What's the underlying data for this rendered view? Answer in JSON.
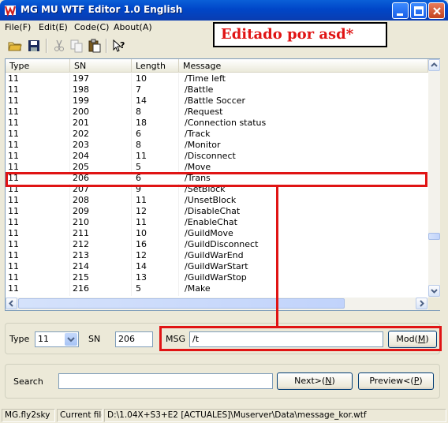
{
  "window": {
    "title": "MG MU WTF Editor 1.0 English"
  },
  "menu": [
    "File(F)",
    "Edit(E)",
    "Code(C)",
    "About(A)"
  ],
  "toolbar": {
    "icons": [
      "open-folder-icon",
      "save-icon",
      "cut-icon",
      "copy-icon",
      "paste-icon",
      "help-icon"
    ]
  },
  "banner": {
    "text": "Editado por asd*"
  },
  "list": {
    "columns": [
      "Type",
      "SN",
      "Length",
      "Message"
    ],
    "rows": [
      {
        "type": "11",
        "sn": "197",
        "length": "10",
        "message": "/Time left"
      },
      {
        "type": "11",
        "sn": "198",
        "length": "7",
        "message": "/Battle"
      },
      {
        "type": "11",
        "sn": "199",
        "length": "14",
        "message": "/Battle Soccer"
      },
      {
        "type": "11",
        "sn": "200",
        "length": "8",
        "message": "/Request"
      },
      {
        "type": "11",
        "sn": "201",
        "length": "18",
        "message": "/Connection status"
      },
      {
        "type": "11",
        "sn": "202",
        "length": "6",
        "message": "/Track"
      },
      {
        "type": "11",
        "sn": "203",
        "length": "8",
        "message": "/Monitor"
      },
      {
        "type": "11",
        "sn": "204",
        "length": "11",
        "message": "/Disconnect"
      },
      {
        "type": "11",
        "sn": "205",
        "length": "5",
        "message": "/Move"
      },
      {
        "type": "11",
        "sn": "206",
        "length": "6",
        "message": "/Trans"
      },
      {
        "type": "11",
        "sn": "207",
        "length": "9",
        "message": "/SetBlock"
      },
      {
        "type": "11",
        "sn": "208",
        "length": "11",
        "message": "/UnsetBlock"
      },
      {
        "type": "11",
        "sn": "209",
        "length": "12",
        "message": "/DisableChat"
      },
      {
        "type": "11",
        "sn": "210",
        "length": "11",
        "message": "/EnableChat"
      },
      {
        "type": "11",
        "sn": "211",
        "length": "10",
        "message": "/GuildMove"
      },
      {
        "type": "11",
        "sn": "212",
        "length": "16",
        "message": "/GuildDisconnect"
      },
      {
        "type": "11",
        "sn": "213",
        "length": "12",
        "message": "/GuildWarEnd"
      },
      {
        "type": "11",
        "sn": "214",
        "length": "14",
        "message": "/GuildWarStart"
      },
      {
        "type": "11",
        "sn": "215",
        "length": "13",
        "message": "/GuildWarStop"
      },
      {
        "type": "11",
        "sn": "216",
        "length": "5",
        "message": "/Make"
      }
    ],
    "selected_sn": "206"
  },
  "editor": {
    "type_label": "Type",
    "type_value": "11",
    "sn_label": "SN",
    "sn_value": "206",
    "msg_label": "MSG",
    "msg_value": "/t",
    "mod_button": "Mod(",
    "mod_key": "M",
    "mod_close": ")"
  },
  "search": {
    "label": "Search",
    "value": "",
    "next_button": "Next>(",
    "next_key": "N",
    "next_close": ")",
    "preview_button": "Preview<(",
    "preview_key": "P",
    "preview_close": ")"
  },
  "status": {
    "user": "MG.fly2sky",
    "current_file_label": "Current file",
    "path": "D:\\1.04X+S3+E2 [ACTUALES]\\Muserver\\Data\\message_kor.wtf"
  },
  "colors": {
    "annotation": "#e01414",
    "title_bar": "#0a5fd8"
  }
}
